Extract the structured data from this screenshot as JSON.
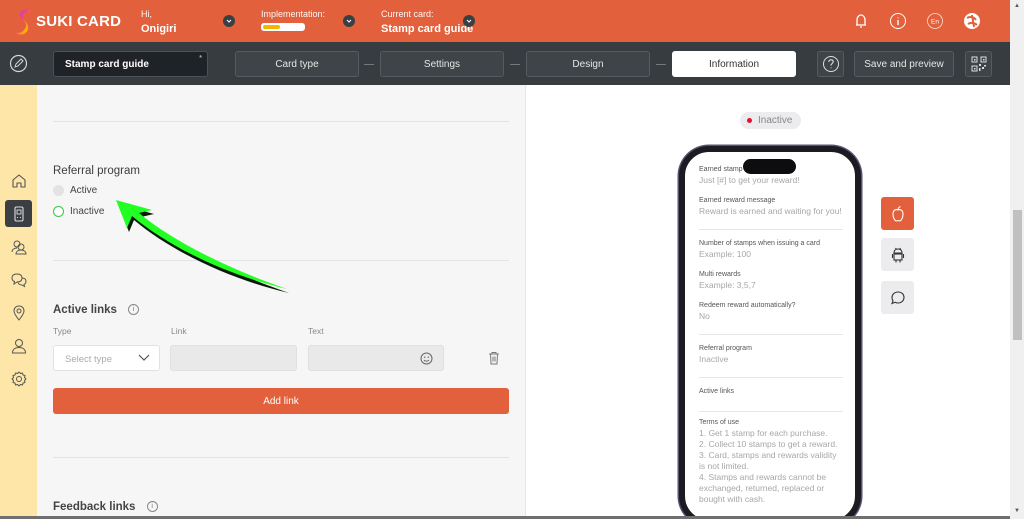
{
  "header": {
    "logo_text": "SUKI CARD",
    "greeting_label": "Hi,",
    "user_name": "Onigiri",
    "implementation_label": "Implementation:",
    "implementation_progress_percent": 45,
    "current_card_label": "Current card:",
    "current_card_name": "Stamp card guide",
    "language_code": "En",
    "icons": [
      "bell-icon",
      "info-icon",
      "language-icon",
      "profile-avatar-icon"
    ]
  },
  "toolbar": {
    "card_name": "Stamp card guide",
    "card_name_marker": "*",
    "steps": [
      {
        "label": "Card type",
        "active": false
      },
      {
        "label": "Settings",
        "active": false
      },
      {
        "label": "Design",
        "active": false
      },
      {
        "label": "Information",
        "active": true
      }
    ],
    "help_icon": "question-icon",
    "save_preview_label": "Save and preview",
    "qr_icon": "qr-code-icon"
  },
  "sidebar": {
    "items": [
      {
        "name": "home",
        "icon": "home-icon",
        "active": false
      },
      {
        "name": "cards",
        "icon": "card-device-icon",
        "active": true
      },
      {
        "name": "clients",
        "icon": "users-icon",
        "active": false
      },
      {
        "name": "messages",
        "icon": "chat-icon",
        "active": false
      },
      {
        "name": "locations",
        "icon": "location-pin-icon",
        "active": false
      },
      {
        "name": "managers",
        "icon": "user-icon",
        "active": false
      },
      {
        "name": "settings",
        "icon": "gear-icon",
        "active": false
      }
    ]
  },
  "form": {
    "referral": {
      "title": "Referral program",
      "options": [
        {
          "label": "Active",
          "selected": false
        },
        {
          "label": "Inactive",
          "selected": true
        }
      ]
    },
    "active_links": {
      "title": "Active links",
      "info_icon": "info-icon",
      "type_label": "Type",
      "type_placeholder": "Select type",
      "link_label": "Link",
      "link_value": "",
      "text_label": "Text",
      "text_value": "",
      "add_button": "Add link"
    },
    "feedback_links": {
      "title": "Feedback links"
    }
  },
  "preview": {
    "status": "Inactive",
    "status_color": "#e8102d",
    "fields": [
      {
        "label": "Earned stamp message",
        "value": "Just [#] to get your reward!"
      },
      {
        "label": "Earned reward message",
        "value": "Reward is earned and waiting for you!"
      },
      {
        "label": "Number of stamps when issuing a card",
        "value": "Example: 100"
      },
      {
        "label": "Multi rewards",
        "value": "Example: 3,5,7"
      },
      {
        "label": "Redeem reward automatically?",
        "value": "No"
      },
      {
        "label": "Referral program",
        "value": "Inactive"
      },
      {
        "label": "Active links",
        "value": ""
      },
      {
        "label": "Terms of use",
        "value": "1. Get 1 stamp for each purchase.\n2. Collect 10 stamps to get a reward.\n3. Card, stamps and rewards validity is not limited.\n4. Stamps and rewards cannot be exchanged, returned, replaced or bought with cash."
      }
    ],
    "platforms": [
      {
        "name": "ios",
        "icon": "apple-icon",
        "active": true
      },
      {
        "name": "android",
        "icon": "android-icon",
        "active": false
      },
      {
        "name": "message",
        "icon": "chat-bubble-icon",
        "active": false
      }
    ]
  },
  "colors": {
    "brand": "#e2603b",
    "toolbar": "#373c41",
    "sidebar": "#fde6a8",
    "radio_selected": "#3ec44b",
    "annotation_arrow": "#22ff22"
  }
}
